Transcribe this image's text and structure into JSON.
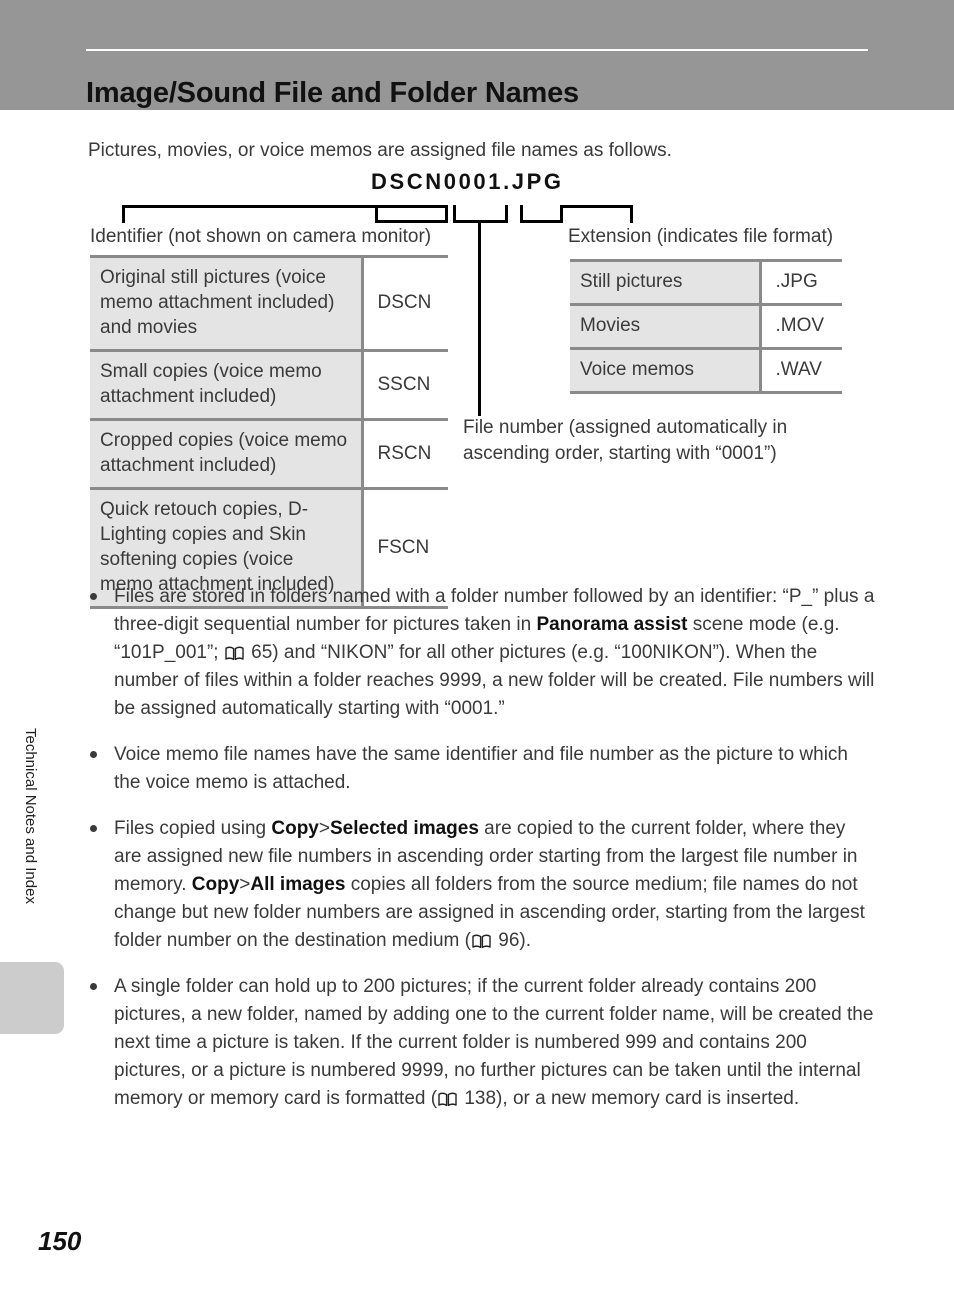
{
  "header": {
    "title": "Image/Sound File and Folder Names",
    "bar_color": "#969696",
    "rule_color": "#ffffff"
  },
  "intro": "Pictures, movies, or voice memos are assigned file names as follows.",
  "diagram": {
    "filename_sample": "DSCN0001.JPG",
    "identifier_caption": "Identifier (not shown on camera monitor)",
    "extension_caption": "Extension (indicates file format)",
    "filenumber_caption": "File number (assigned automatically in ascending order, starting with “0001”)"
  },
  "identifier_table": {
    "rows": [
      {
        "description": "Original still pictures (voice memo attachment included) and movies",
        "code": "DSCN"
      },
      {
        "description": "Small copies (voice memo attachment included)",
        "code": "SSCN"
      },
      {
        "description": "Cropped copies (voice memo attachment included)",
        "code": "RSCN"
      },
      {
        "description": "Quick retouch copies, D-Lighting copies and Skin softening copies (voice memo attachment included)",
        "code": "FSCN"
      }
    ]
  },
  "extension_table": {
    "rows": [
      {
        "description": "Still pictures",
        "code": ".JPG"
      },
      {
        "description": "Movies",
        "code": ".MOV"
      },
      {
        "description": "Voice memos",
        "code": ".WAV"
      }
    ]
  },
  "bullets": [
    {
      "segments": [
        {
          "t": "Files are stored in folders named with a folder number followed by an identifier: “P_” plus a three-digit sequential number for pictures taken in "
        },
        {
          "t": "Panorama assist",
          "bold": true
        },
        {
          "t": " scene mode (e.g. “101P_001”; "
        },
        {
          "icon": "book-icon"
        },
        {
          "t": " 65) and “NIKON” for all other pictures (e.g. “100NIKON”). When the number of files within a folder reaches 9999, a new folder will be created. File numbers will be assigned automatically starting with “0001.”"
        }
      ]
    },
    {
      "segments": [
        {
          "t": "Voice memo file names have the same identifier and file number as the picture to which the voice memo is attached."
        }
      ]
    },
    {
      "segments": [
        {
          "t": "Files copied using "
        },
        {
          "t": "Copy",
          "bold": true
        },
        {
          "t": ">"
        },
        {
          "t": "Selected images",
          "bold": true
        },
        {
          "t": " are copied to the current folder, where they are assigned new file numbers in ascending order starting from the largest file number in memory. "
        },
        {
          "t": "Copy",
          "bold": true
        },
        {
          "t": ">"
        },
        {
          "t": "All images",
          "bold": true
        },
        {
          "t": " copies all folders from the source medium; file names do not change but new folder numbers are assigned in ascending order, starting from the largest folder number on the destination medium ("
        },
        {
          "icon": "book-icon"
        },
        {
          "t": " 96)."
        }
      ]
    },
    {
      "segments": [
        {
          "t": "A single folder can hold up to 200 pictures; if the current folder already contains 200 pictures, a new folder, named by adding one to the current folder name, will be created the next time a picture is taken. If the current folder is numbered 999 and contains 200 pictures, or a picture is numbered 9999, no further pictures can be taken until the internal memory or memory card is formatted ("
        },
        {
          "icon": "book-icon"
        },
        {
          "t": " 138), or a new memory card is inserted."
        }
      ]
    }
  ],
  "side_tab": {
    "label": "Technical Notes and Index",
    "color": "#cccccc"
  },
  "page_number": "150"
}
